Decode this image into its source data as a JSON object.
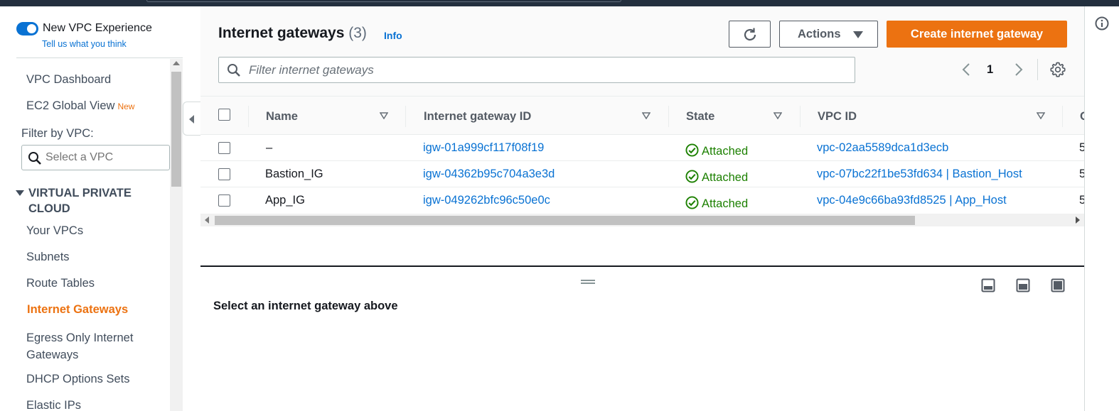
{
  "sidebar": {
    "toggle_label": "New VPC Experience",
    "toggle_on": true,
    "feedback_link": "Tell us what you think",
    "nav_top": [
      {
        "label": "VPC Dashboard",
        "badge": ""
      },
      {
        "label": "EC2 Global View",
        "badge": "New"
      }
    ],
    "filter_label": "Filter by VPC:",
    "filter_placeholder": "Select a VPC",
    "section_title": "VIRTUAL PRIVATE CLOUD",
    "nav_section": [
      {
        "label": "Your VPCs"
      },
      {
        "label": "Subnets"
      },
      {
        "label": "Route Tables"
      },
      {
        "label": "Internet Gateways"
      },
      {
        "label": "Egress Only Internet Gateways"
      },
      {
        "label": "DHCP Options Sets"
      },
      {
        "label": "Elastic IPs"
      }
    ],
    "active_item": "Internet Gateways"
  },
  "header": {
    "title": "Internet gateways",
    "count": "(3)",
    "info": "Info",
    "actions_label": "Actions",
    "create_label": "Create internet gateway",
    "refresh_icon": "refresh-icon"
  },
  "filter": {
    "placeholder": "Filter internet gateways"
  },
  "pagination": {
    "current_page": "1"
  },
  "table": {
    "columns": [
      "Name",
      "Internet gateway ID",
      "State",
      "VPC ID",
      "O"
    ],
    "rows": [
      {
        "name": "–",
        "id": "igw-01a999cf117f08f19",
        "state": "Attached",
        "vpc": "vpc-02aa5589dca1d3ecb",
        "owner": "5"
      },
      {
        "name": "Bastion_IG",
        "id": "igw-04362b95c704a3e3d",
        "state": "Attached",
        "vpc": "vpc-07bc22f1be53fd634 | Bastion_Host",
        "owner": "5"
      },
      {
        "name": "App_IG",
        "id": "igw-049262bfc96c50e0c",
        "state": "Attached",
        "vpc": "vpc-04e9c66ba93fd8525 | App_Host",
        "owner": "5"
      }
    ]
  },
  "details": {
    "message": "Select an internet gateway above"
  },
  "colors": {
    "accent": "#ec7211",
    "link": "#0972d3",
    "success": "#1d8102",
    "nav_dark": "#232f3e"
  }
}
